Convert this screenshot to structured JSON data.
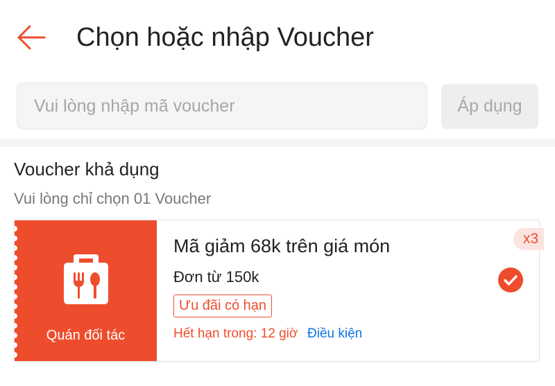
{
  "header": {
    "title": "Chọn hoặc nhập Voucher",
    "back_icon": "arrow-left-icon"
  },
  "voucher_input": {
    "placeholder": "Vui lòng nhập mã voucher",
    "value": "",
    "apply_label": "Áp dụng"
  },
  "section": {
    "title": "Voucher khả dụng",
    "subtitle": "Vui lòng chỉ chọn 01 Voucher"
  },
  "vouchers": [
    {
      "shop_icon": "shop-utensils-icon",
      "shop_label": "Quán đối tác",
      "name": "Mã giảm 68k trên giá món",
      "min_order": "Đơn từ 150k",
      "tag": "Ưu đãi có hạn",
      "expiry": "Hết hạn trong: 12 giờ",
      "conditions_link": "Điều kiện",
      "quantity_badge": "x3",
      "selected": true
    }
  ],
  "colors": {
    "accent": "#ee4d2d",
    "link": "#0b74e5",
    "badge_bg": "#fbe4e0"
  }
}
